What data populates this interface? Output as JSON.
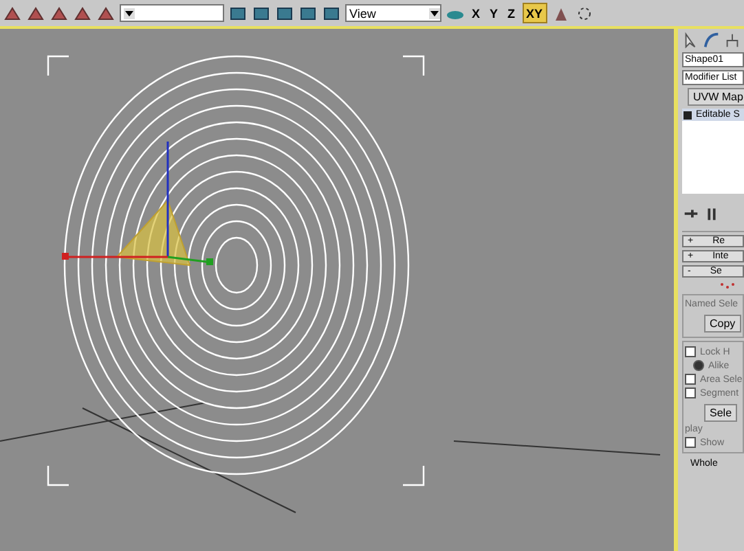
{
  "toolbar": {
    "view_dropdown": "View",
    "axis_buttons": [
      {
        "label": "X",
        "selected": false
      },
      {
        "label": "Y",
        "selected": false
      },
      {
        "label": "Z",
        "selected": false
      },
      {
        "label": "XY",
        "selected": true
      }
    ]
  },
  "command_panel": {
    "object_name": "Shape01",
    "modifier_list": "Modifier List",
    "modifier_button": "UVW Map",
    "stack_items": [
      {
        "label": "Editable S"
      }
    ],
    "rollouts": [
      {
        "sign": "+",
        "label": "Re"
      },
      {
        "sign": "+",
        "label": "Inte"
      },
      {
        "sign": "-",
        "label": "Se"
      }
    ],
    "named_selections": {
      "label": "Named Sele",
      "button": "Copy"
    },
    "options": [
      {
        "kind": "checkbox",
        "label": "Lock H",
        "checked": false
      },
      {
        "kind": "radio",
        "label": "Alike",
        "checked": true
      },
      {
        "kind": "checkbox",
        "label": "Area Sele",
        "checked": false
      },
      {
        "kind": "checkbox",
        "label": "Segment",
        "checked": false
      }
    ],
    "select_button": "Sele",
    "display_label": "play",
    "display_options": [
      {
        "label": "Show",
        "checked": false
      }
    ],
    "footer": "Whole"
  }
}
